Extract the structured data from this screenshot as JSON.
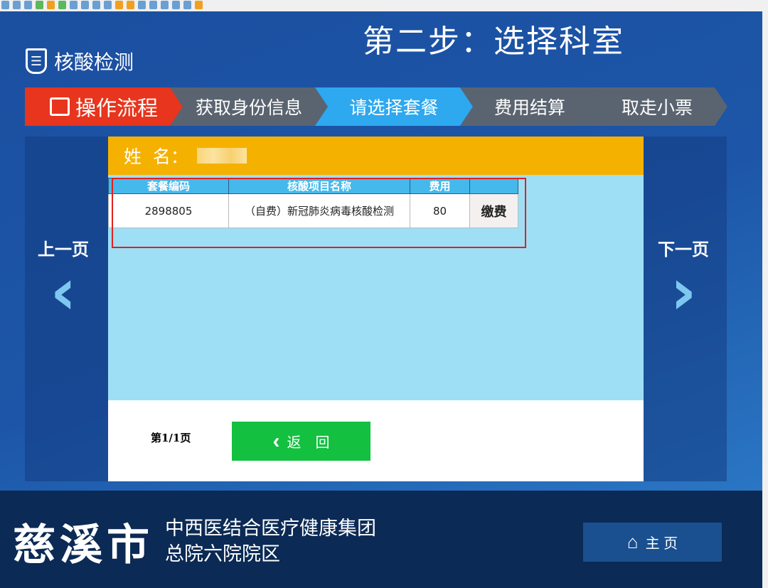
{
  "header": {
    "step_title": "第二步：选择科室",
    "app_title": "核酸检测"
  },
  "steps": [
    {
      "label": "操作流程"
    },
    {
      "label": "获取身份信息"
    },
    {
      "label": "请选择套餐"
    },
    {
      "label": "费用结算"
    },
    {
      "label": "取走小票"
    }
  ],
  "nav": {
    "prev": "上一页",
    "next": "下一页"
  },
  "patient": {
    "name_label": "姓  名："
  },
  "table": {
    "headers": [
      "套餐编码",
      "核酸项目名称",
      "费用",
      ""
    ],
    "rows": [
      {
        "code": "2898805",
        "name": "（自费）新冠肺炎病毒核酸检测",
        "fee": "80",
        "action": "缴费"
      }
    ]
  },
  "pagination": {
    "text": "第1/1页"
  },
  "back_label": "返　回",
  "footer": {
    "city": "慈溪市",
    "org_line1": "中西医结合医疗健康集团",
    "org_line2": "总院六院院区",
    "home_label": "主 页"
  },
  "colors": {
    "step_active": "#e8351d",
    "step_current": "#2ea8ee",
    "step_inactive": "#5a6470",
    "accent_orange": "#f5b100",
    "back_green": "#13c040"
  }
}
